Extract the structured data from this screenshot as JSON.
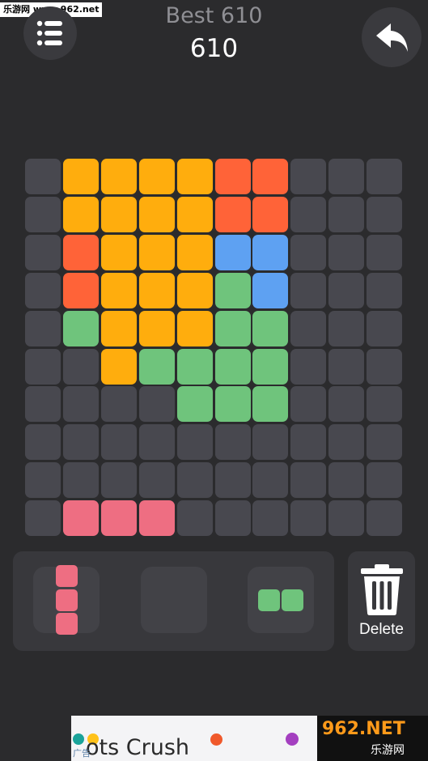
{
  "watermark": "乐游网 www.962.net",
  "header": {
    "best_text": "Best 610",
    "score_text": "610",
    "menu_icon": "list-menu-icon",
    "undo_icon": "undo-arrow-icon"
  },
  "colors": {
    "background": "#2b2b2d",
    "empty": "#48484f",
    "orange": "#ffad0d",
    "red": "#ff6338",
    "blue": "#5ea1f2",
    "green": "#6fc47c",
    "pink": "#ee6e82"
  },
  "board": {
    "size": 10,
    "rows": [
      "EOOOORREEE",
      "EOOOORREEE",
      "EROOOBBEEE",
      "EROOOGBEEE",
      "EGOOOGGEEE",
      "EEOGGGGEEE",
      "EEEEGGGEEE",
      "EEEEEEEEEE",
      "EEEEEEEEEE",
      "EPPPEEEEEE"
    ]
  },
  "tray": {
    "pieces": [
      {
        "color": "pink",
        "shape": "vertical-3"
      },
      {
        "color": "",
        "shape": "empty"
      },
      {
        "color": "green",
        "shape": "horizontal-2"
      }
    ]
  },
  "delete": {
    "label": "Delete",
    "icon": "trash-can-icon"
  },
  "ad": {
    "title": "ots Crush",
    "tag": "广告",
    "logo_text": "962.NET",
    "logo_sub": "乐游网"
  }
}
